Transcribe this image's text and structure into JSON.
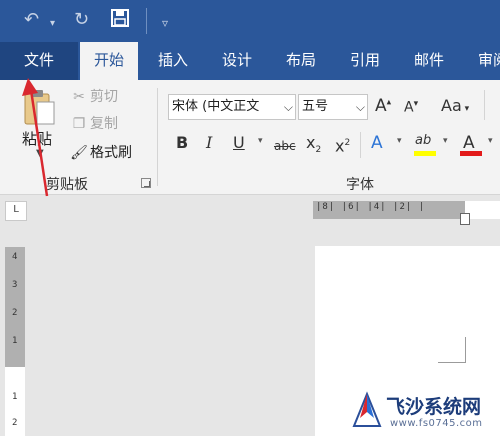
{
  "quick_access": {
    "undo_icon": "undo-icon",
    "redo_icon": "redo-icon",
    "save_icon": "save-icon",
    "customize_icon": "chevron-down-icon"
  },
  "tabs": [
    {
      "label": "文件"
    },
    {
      "label": "开始"
    },
    {
      "label": "插入"
    },
    {
      "label": "设计"
    },
    {
      "label": "布局"
    },
    {
      "label": "引用"
    },
    {
      "label": "邮件"
    },
    {
      "label": "审阅"
    }
  ],
  "clipboard": {
    "paste_label": "粘贴",
    "cut_label": "剪切",
    "copy_label": "复制",
    "format_painter_label": "格式刷",
    "group_label": "剪贴板"
  },
  "font": {
    "font_name": "宋体 (中文正文",
    "font_size": "五号",
    "grow": "A",
    "shrink": "A",
    "change_case": "Aa",
    "bold": "B",
    "italic": "I",
    "underline": "U",
    "strike": "abc",
    "subscript_base": "x",
    "subscript_mark": "2",
    "superscript_base": "x",
    "superscript_mark": "2",
    "text_effect": "A",
    "highlight": "ab",
    "font_color": "A",
    "group_label": "字体"
  },
  "ruler": {
    "corner_mark": "L",
    "horizontal_ticks": "|8| |6| |4| |2| |",
    "vertical_ticks": [
      "4",
      "3",
      "2",
      "1"
    ],
    "vertical_ticks_lower": [
      "1",
      "2"
    ]
  },
  "colors": {
    "titlebar": "#2b579a",
    "highlight": "#ffff00",
    "font_color": "#e21a1a",
    "annotation_arrow": "#d9282f"
  },
  "watermark": {
    "name": "飞沙系统网",
    "url": "www.fs0745.com"
  }
}
